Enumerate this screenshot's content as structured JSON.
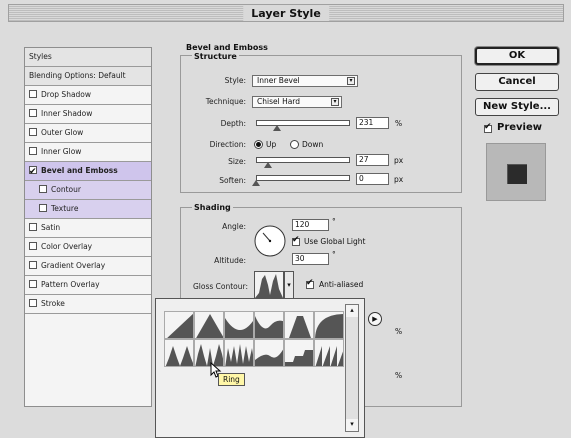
{
  "window": {
    "title": "Layer Style"
  },
  "styles": {
    "header": "Styles",
    "blending": "Blending Options: Default",
    "items": [
      {
        "label": "Drop Shadow",
        "checked": false
      },
      {
        "label": "Inner Shadow",
        "checked": false
      },
      {
        "label": "Outer Glow",
        "checked": false
      },
      {
        "label": "Inner Glow",
        "checked": false
      },
      {
        "label": "Bevel and Emboss",
        "checked": true
      },
      {
        "label": "Contour",
        "checked": false
      },
      {
        "label": "Texture",
        "checked": false
      },
      {
        "label": "Satin",
        "checked": false
      },
      {
        "label": "Color Overlay",
        "checked": false
      },
      {
        "label": "Gradient Overlay",
        "checked": false
      },
      {
        "label": "Pattern Overlay",
        "checked": false
      },
      {
        "label": "Stroke",
        "checked": false
      }
    ]
  },
  "bevel": {
    "title": "Bevel and Emboss",
    "structure": "Structure",
    "style_label": "Style:",
    "style_value": "Inner Bevel",
    "technique_label": "Technique:",
    "technique_value": "Chisel Hard",
    "depth_label": "Depth:",
    "depth_value": "231",
    "depth_unit": "%",
    "direction_label": "Direction:",
    "direction_up": "Up",
    "direction_down": "Down",
    "size_label": "Size:",
    "size_value": "27",
    "size_unit": "px",
    "soften_label": "Soften:",
    "soften_value": "0",
    "soften_unit": "px"
  },
  "shading": {
    "title": "Shading",
    "angle_label": "Angle:",
    "angle_value": "120",
    "degree": "°",
    "use_global_light": "Use Global Light",
    "altitude_label": "Altitude:",
    "altitude_value": "30",
    "gloss_label": "Gloss Contour:",
    "anti_aliased": "Anti-aliased",
    "partial_pct_1": "%",
    "partial_pct_2": "%"
  },
  "buttons": {
    "ok": "OK",
    "cancel": "Cancel",
    "new_style": "New Style...",
    "preview": "Preview"
  },
  "picker": {
    "tooltip": "Ring"
  }
}
